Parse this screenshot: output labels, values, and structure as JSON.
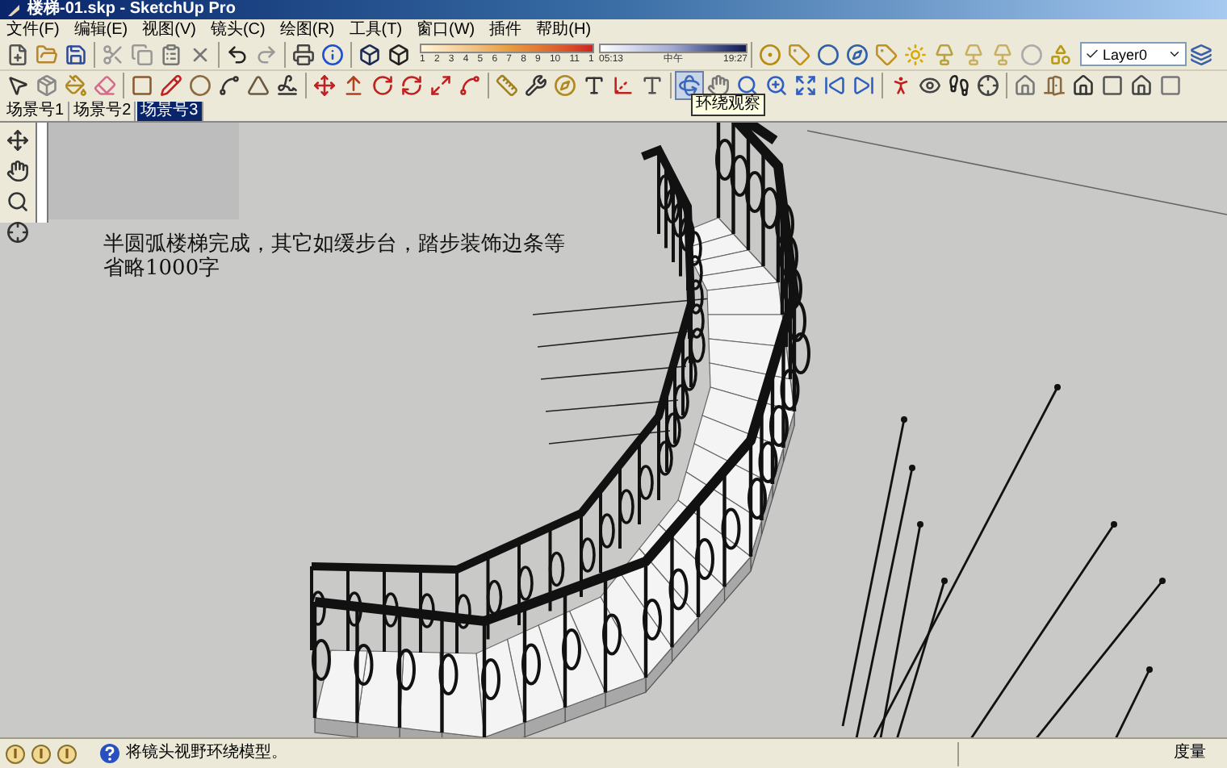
{
  "window": {
    "title": "楼梯-01.skp - SketchUp Pro"
  },
  "menu": [
    "文件(F)",
    "编辑(E)",
    "视图(V)",
    "镜头(C)",
    "绘图(R)",
    "工具(T)",
    "窗口(W)",
    "插件",
    "帮助(H)"
  ],
  "shadow_settings": {
    "month_ticks": [
      "1",
      "2",
      "3",
      "4",
      "5",
      "6",
      "7",
      "8",
      "9",
      "10",
      "11",
      "1"
    ],
    "start_time": "05:13",
    "noon": "中午",
    "end_time": "19:27"
  },
  "layer_dropdown": {
    "value": "Layer0"
  },
  "navigation_tools": [
    {
      "selected": true
    },
    {
      "selected": false
    },
    {
      "selected": false
    },
    {
      "selected": false
    },
    {
      "selected": false
    },
    {
      "selected": false
    },
    {
      "selected": false
    }
  ],
  "tooltip": "环绕观察",
  "scene_tabs": [
    {
      "label": "场景号1",
      "selected": false
    },
    {
      "label": "场景号2",
      "selected": false
    },
    {
      "label": "场景号3",
      "selected": true
    }
  ],
  "annotation": "半圆弧楼梯完成，其它如缓步台，踏步装饰边条等省略1000字",
  "status_bar": {
    "hint": "将镜头视野环绕模型。",
    "measurements_label": "度量"
  }
}
